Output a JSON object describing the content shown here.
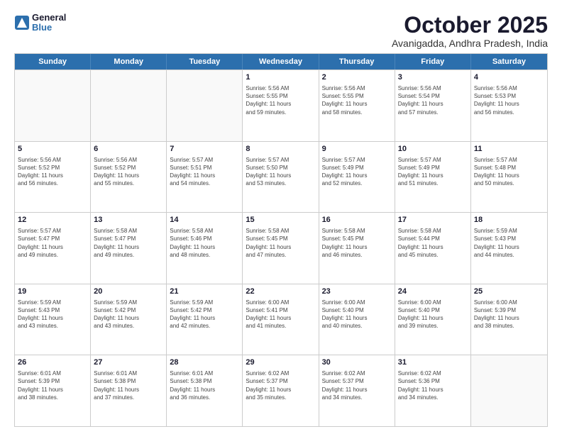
{
  "header": {
    "logo_general": "General",
    "logo_blue": "Blue",
    "title": "October 2025",
    "subtitle": "Avanigadda, Andhra Pradesh, India"
  },
  "days": [
    "Sunday",
    "Monday",
    "Tuesday",
    "Wednesday",
    "Thursday",
    "Friday",
    "Saturday"
  ],
  "weeks": [
    [
      {
        "day": null,
        "info": ""
      },
      {
        "day": null,
        "info": ""
      },
      {
        "day": null,
        "info": ""
      },
      {
        "day": "1",
        "info": "Sunrise: 5:56 AM\nSunset: 5:55 PM\nDaylight: 11 hours\nand 59 minutes."
      },
      {
        "day": "2",
        "info": "Sunrise: 5:56 AM\nSunset: 5:55 PM\nDaylight: 11 hours\nand 58 minutes."
      },
      {
        "day": "3",
        "info": "Sunrise: 5:56 AM\nSunset: 5:54 PM\nDaylight: 11 hours\nand 57 minutes."
      },
      {
        "day": "4",
        "info": "Sunrise: 5:56 AM\nSunset: 5:53 PM\nDaylight: 11 hours\nand 56 minutes."
      }
    ],
    [
      {
        "day": "5",
        "info": "Sunrise: 5:56 AM\nSunset: 5:52 PM\nDaylight: 11 hours\nand 56 minutes."
      },
      {
        "day": "6",
        "info": "Sunrise: 5:56 AM\nSunset: 5:52 PM\nDaylight: 11 hours\nand 55 minutes."
      },
      {
        "day": "7",
        "info": "Sunrise: 5:57 AM\nSunset: 5:51 PM\nDaylight: 11 hours\nand 54 minutes."
      },
      {
        "day": "8",
        "info": "Sunrise: 5:57 AM\nSunset: 5:50 PM\nDaylight: 11 hours\nand 53 minutes."
      },
      {
        "day": "9",
        "info": "Sunrise: 5:57 AM\nSunset: 5:49 PM\nDaylight: 11 hours\nand 52 minutes."
      },
      {
        "day": "10",
        "info": "Sunrise: 5:57 AM\nSunset: 5:49 PM\nDaylight: 11 hours\nand 51 minutes."
      },
      {
        "day": "11",
        "info": "Sunrise: 5:57 AM\nSunset: 5:48 PM\nDaylight: 11 hours\nand 50 minutes."
      }
    ],
    [
      {
        "day": "12",
        "info": "Sunrise: 5:57 AM\nSunset: 5:47 PM\nDaylight: 11 hours\nand 49 minutes."
      },
      {
        "day": "13",
        "info": "Sunrise: 5:58 AM\nSunset: 5:47 PM\nDaylight: 11 hours\nand 49 minutes."
      },
      {
        "day": "14",
        "info": "Sunrise: 5:58 AM\nSunset: 5:46 PM\nDaylight: 11 hours\nand 48 minutes."
      },
      {
        "day": "15",
        "info": "Sunrise: 5:58 AM\nSunset: 5:45 PM\nDaylight: 11 hours\nand 47 minutes."
      },
      {
        "day": "16",
        "info": "Sunrise: 5:58 AM\nSunset: 5:45 PM\nDaylight: 11 hours\nand 46 minutes."
      },
      {
        "day": "17",
        "info": "Sunrise: 5:58 AM\nSunset: 5:44 PM\nDaylight: 11 hours\nand 45 minutes."
      },
      {
        "day": "18",
        "info": "Sunrise: 5:59 AM\nSunset: 5:43 PM\nDaylight: 11 hours\nand 44 minutes."
      }
    ],
    [
      {
        "day": "19",
        "info": "Sunrise: 5:59 AM\nSunset: 5:43 PM\nDaylight: 11 hours\nand 43 minutes."
      },
      {
        "day": "20",
        "info": "Sunrise: 5:59 AM\nSunset: 5:42 PM\nDaylight: 11 hours\nand 43 minutes."
      },
      {
        "day": "21",
        "info": "Sunrise: 5:59 AM\nSunset: 5:42 PM\nDaylight: 11 hours\nand 42 minutes."
      },
      {
        "day": "22",
        "info": "Sunrise: 6:00 AM\nSunset: 5:41 PM\nDaylight: 11 hours\nand 41 minutes."
      },
      {
        "day": "23",
        "info": "Sunrise: 6:00 AM\nSunset: 5:40 PM\nDaylight: 11 hours\nand 40 minutes."
      },
      {
        "day": "24",
        "info": "Sunrise: 6:00 AM\nSunset: 5:40 PM\nDaylight: 11 hours\nand 39 minutes."
      },
      {
        "day": "25",
        "info": "Sunrise: 6:00 AM\nSunset: 5:39 PM\nDaylight: 11 hours\nand 38 minutes."
      }
    ],
    [
      {
        "day": "26",
        "info": "Sunrise: 6:01 AM\nSunset: 5:39 PM\nDaylight: 11 hours\nand 38 minutes."
      },
      {
        "day": "27",
        "info": "Sunrise: 6:01 AM\nSunset: 5:38 PM\nDaylight: 11 hours\nand 37 minutes."
      },
      {
        "day": "28",
        "info": "Sunrise: 6:01 AM\nSunset: 5:38 PM\nDaylight: 11 hours\nand 36 minutes."
      },
      {
        "day": "29",
        "info": "Sunrise: 6:02 AM\nSunset: 5:37 PM\nDaylight: 11 hours\nand 35 minutes."
      },
      {
        "day": "30",
        "info": "Sunrise: 6:02 AM\nSunset: 5:37 PM\nDaylight: 11 hours\nand 34 minutes."
      },
      {
        "day": "31",
        "info": "Sunrise: 6:02 AM\nSunset: 5:36 PM\nDaylight: 11 hours\nand 34 minutes."
      },
      {
        "day": null,
        "info": ""
      }
    ]
  ]
}
